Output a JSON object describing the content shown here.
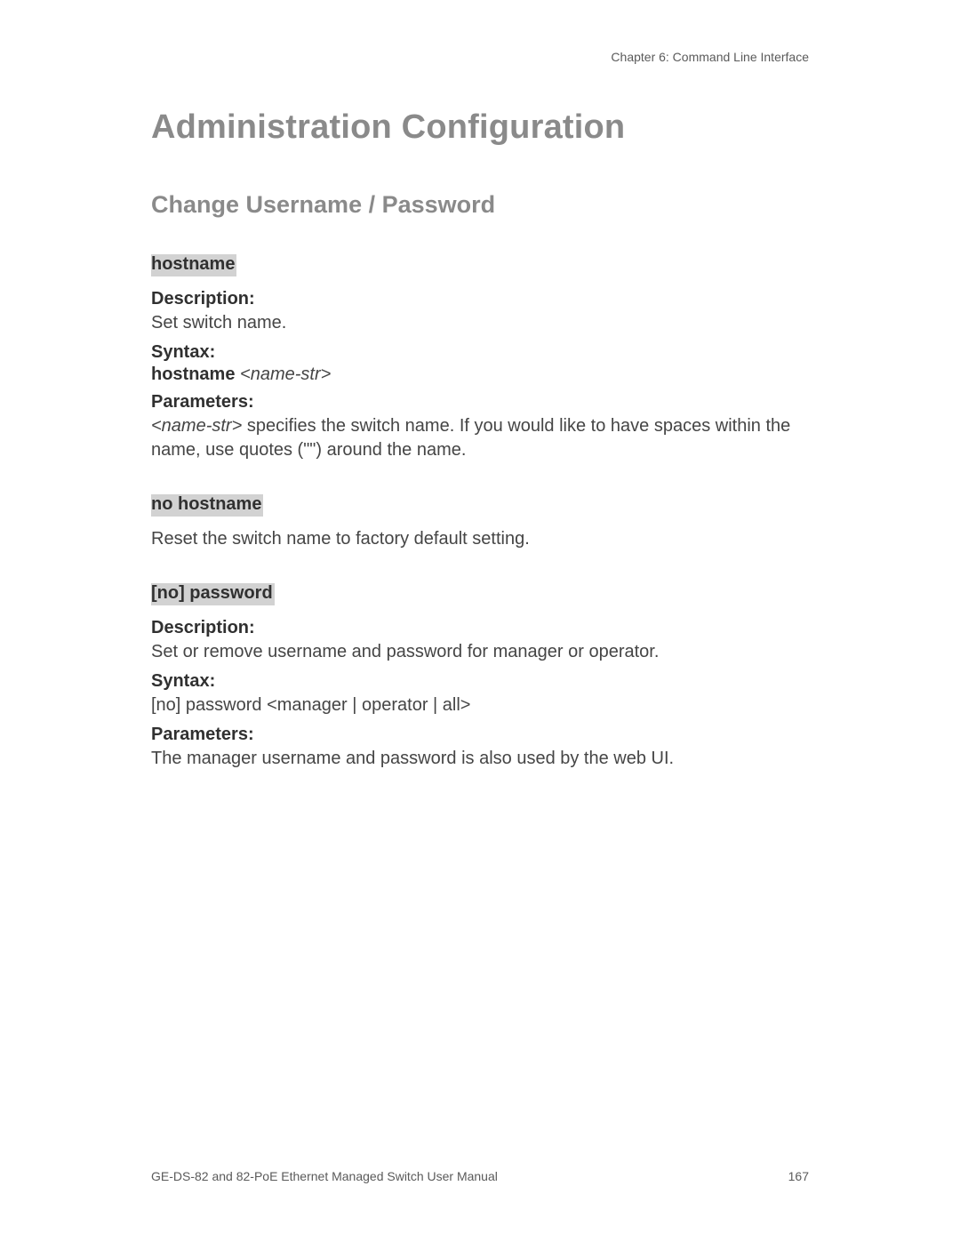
{
  "chapter_header": "Chapter 6: Command Line Interface",
  "title": "Administration Configuration",
  "subtitle": "Change Username / Password",
  "labels": {
    "description": "Description:",
    "syntax": "Syntax:",
    "parameters": "Parameters:"
  },
  "hostname": {
    "name": "hostname",
    "description_text": "Set switch name.",
    "syntax_kw": "hostname",
    "syntax_arg": "<name-str>",
    "param_arg": "<name-str>",
    "param_rest": " specifies the switch name. If you would like to have spaces within the name, use quotes (\"\") around the name."
  },
  "no_hostname": {
    "name": "no hostname",
    "text": "Reset the switch name to factory default setting."
  },
  "password": {
    "name": "[no] password",
    "description_text": "Set or remove username and password for manager or operator.",
    "syntax_text": "[no] password <manager | operator | all>",
    "param_text": "The manager username and password is also used by the web UI."
  },
  "footer": {
    "manual_title": "GE-DS-82 and 82-PoE Ethernet Managed Switch User Manual",
    "page_number": "167"
  }
}
